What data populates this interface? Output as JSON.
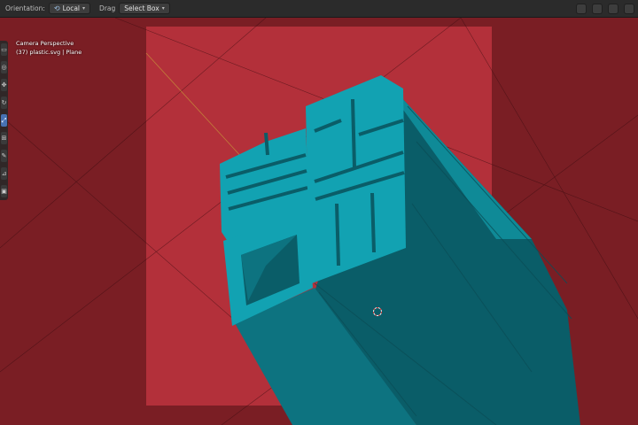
{
  "header": {
    "orientation_label": "Orientation:",
    "orientation_value": "Local",
    "drag_label": "Drag",
    "drag_value": "Select Box"
  },
  "viewport": {
    "view_name": "Camera Perspective",
    "object_info": "(37) plastic.svg | Plane"
  },
  "toolbar": {
    "tools": [
      "select-box",
      "cursor",
      "move",
      "rotate",
      "scale",
      "transform",
      "annotate",
      "measure",
      "add-cube"
    ],
    "active_tool_index": 4
  },
  "colors": {
    "background_outer": "#7a1e24",
    "camera_frame": "#b3303a",
    "object_top": "#12a2b2",
    "object_side": "#0d7380",
    "object_dark": "#0a5d68",
    "accent_active": "#4772b3"
  }
}
